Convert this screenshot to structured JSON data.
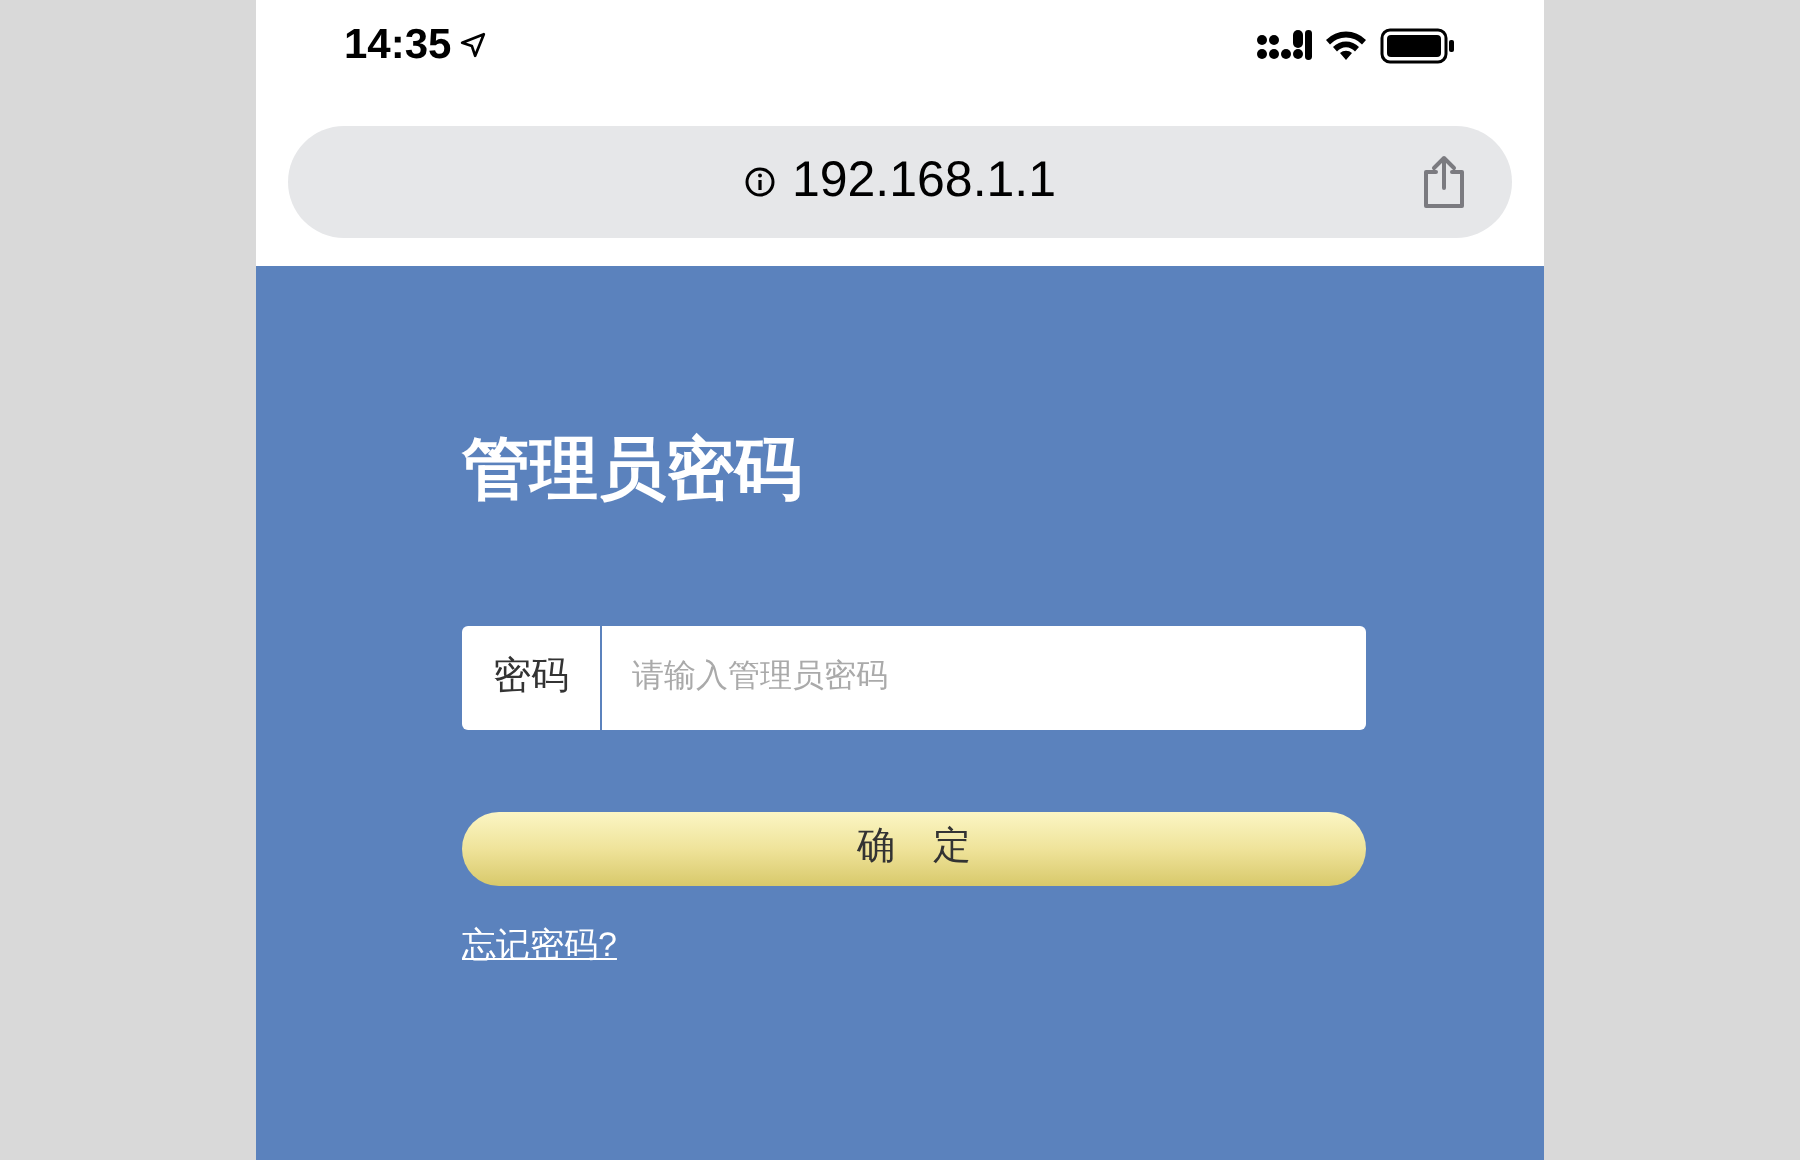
{
  "status_bar": {
    "time": "14:35"
  },
  "address_bar": {
    "url": "192.168.1.1"
  },
  "login": {
    "title": "管理员密码",
    "field": {
      "label": "密码",
      "placeholder": "请输入管理员密码"
    },
    "button": "确　定",
    "link": "忘记密码?"
  }
}
